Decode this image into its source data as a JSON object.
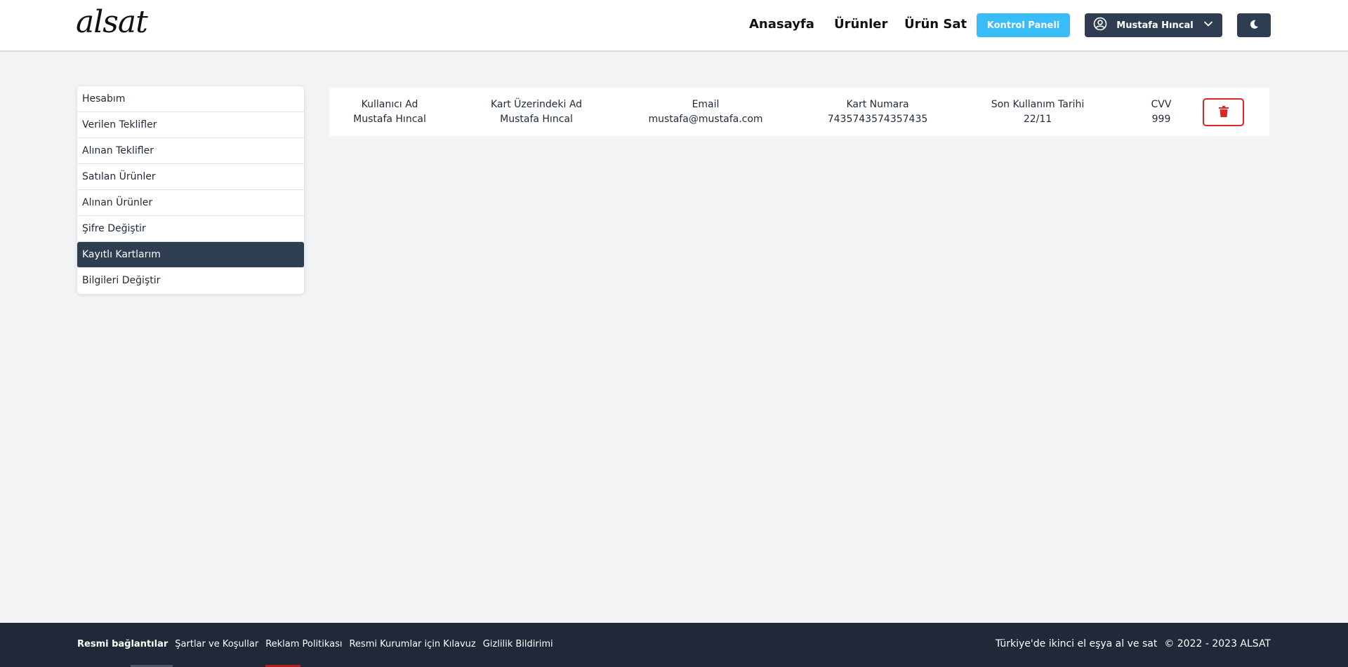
{
  "header": {
    "logo": "alsat",
    "nav": {
      "home": "Anasayfa",
      "products": "Ürünler",
      "sell": "Ürün Sat"
    },
    "control_panel": "Kontrol Paneli",
    "user_name": "Mustafa Hıncal",
    "icons": {
      "user": "user-circle-icon",
      "chevron": "chevron-down-icon",
      "theme": "moon-icon"
    }
  },
  "sidebar": {
    "items": [
      {
        "label": "Hesabım"
      },
      {
        "label": "Verilen Teklifler"
      },
      {
        "label": "Alınan Teklifler"
      },
      {
        "label": "Satılan Ürünler"
      },
      {
        "label": "Alınan Ürünler"
      },
      {
        "label": "Şifre Değiştir"
      },
      {
        "label": "Kayıtlı Kartlarım",
        "active": true
      },
      {
        "label": "Bilgileri Değiştir"
      }
    ]
  },
  "card": {
    "columns": [
      {
        "header": "Kullanıcı Ad",
        "value": "Mustafa Hıncal"
      },
      {
        "header": "Kart Üzerindeki Ad",
        "value": "Mustafa Hıncal"
      },
      {
        "header": "Email",
        "value": "mustafa@mustafa.com"
      },
      {
        "header": "Kart Numara",
        "value": "7435743574357435"
      },
      {
        "header": "Son Kullanım Tarihi",
        "value": "22/11"
      },
      {
        "header": "CVV",
        "value": "999"
      }
    ],
    "delete_icon": "trash-icon",
    "delete_color": "#dc2626"
  },
  "footer": {
    "links_title": "Resmi bağlantılar",
    "links": [
      "Şartlar ve Koşullar",
      "Reklam Politikası",
      "Resmi Kurumlar için Kılavuz",
      "Gizlilik Bildirimi"
    ],
    "tagline": "Türkiye'de ikinci el eşya al ve sat",
    "copyright": "© 2022 - 2023 ALSAT"
  },
  "colors": {
    "accent": "#38bdf8",
    "dark": "#2f3d52",
    "footer_bg": "#1f2937",
    "page_bg": "#f2f3f5"
  }
}
